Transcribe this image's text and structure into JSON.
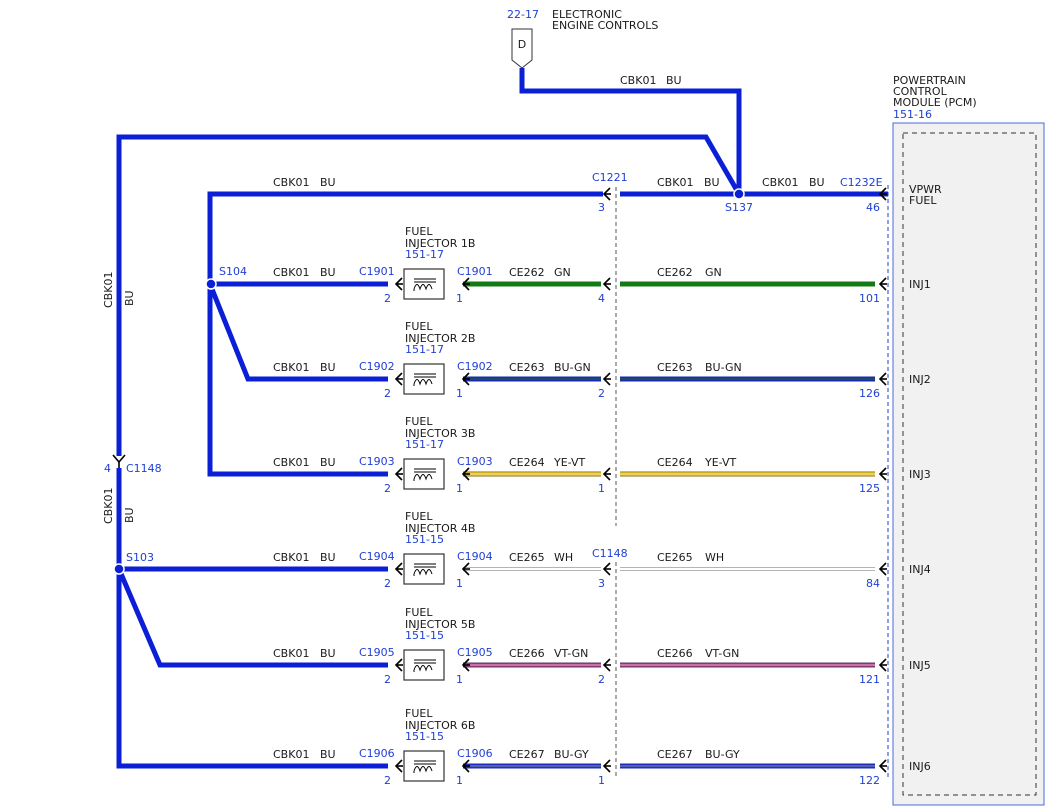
{
  "header": {
    "ref": "22-17",
    "title_line1": "ELECTRONIC",
    "title_line2": "ENGINE CONTROLS",
    "connector_letter": "D"
  },
  "pcm": {
    "line1": "POWERTRAIN",
    "line2": "CONTROL",
    "line3": "MODULE (PCM)",
    "ref": "151-16",
    "vpwr_line1": "VPWR",
    "vpwr_line2": "FUEL",
    "vpwr_connector": "C1232E",
    "vpwr_pin": "46"
  },
  "feed": {
    "top_circuit": "CBK01",
    "top_color": "BU",
    "splice_s137": "S137",
    "mid_left_circuit": "CBK01",
    "mid_left_color": "BU",
    "mid_right_circuit": "CBK01",
    "mid_right_color": "BU",
    "c1221_label": "C1221",
    "c1221_pin": "3",
    "left_circuit": "CBK01",
    "left_color": "BU",
    "vert_circuit_upper": "CBK01",
    "vert_color_upper": "BU",
    "vert_circuit_lower": "CBK01",
    "vert_color_lower": "BU",
    "c1148_pin": "4",
    "c1148_label": "C1148",
    "splice_s104": "S104",
    "splice_s103": "S103",
    "c1148_mid_label": "C1148"
  },
  "injectors": [
    {
      "name1": "FUEL",
      "name2": "INJECTOR 1B",
      "ref": "151-17",
      "conn": "C1901",
      "feed_circuit": "CBK01",
      "feed_color": "BU",
      "pin_in": "2",
      "pin_out": "1",
      "circuit": "CE262",
      "color": "GN",
      "mid_pin": "4",
      "pcm_pin": "101",
      "pcm_label": "INJ1"
    },
    {
      "name1": "FUEL",
      "name2": "INJECTOR 2B",
      "ref": "151-17",
      "conn": "C1902",
      "feed_circuit": "CBK01",
      "feed_color": "BU",
      "pin_in": "2",
      "pin_out": "1",
      "circuit": "CE263",
      "color": "BU-GN",
      "mid_pin": "2",
      "pcm_pin": "126",
      "pcm_label": "INJ2"
    },
    {
      "name1": "FUEL",
      "name2": "INJECTOR 3B",
      "ref": "151-17",
      "conn": "C1903",
      "feed_circuit": "CBK01",
      "feed_color": "BU",
      "pin_in": "2",
      "pin_out": "1",
      "circuit": "CE264",
      "color": "YE-VT",
      "mid_pin": "1",
      "pcm_pin": "125",
      "pcm_label": "INJ3"
    },
    {
      "name1": "FUEL",
      "name2": "INJECTOR 4B",
      "ref": "151-15",
      "conn": "C1904",
      "feed_circuit": "CBK01",
      "feed_color": "BU",
      "pin_in": "2",
      "pin_out": "1",
      "circuit": "CE265",
      "color": "WH",
      "mid_pin": "3",
      "pcm_pin": "84",
      "pcm_label": "INJ4"
    },
    {
      "name1": "FUEL",
      "name2": "INJECTOR 5B",
      "ref": "151-15",
      "conn": "C1905",
      "feed_circuit": "CBK01",
      "feed_color": "BU",
      "pin_in": "2",
      "pin_out": "1",
      "circuit": "CE266",
      "color": "VT-GN",
      "mid_pin": "2",
      "pcm_pin": "121",
      "pcm_label": "INJ5"
    },
    {
      "name1": "FUEL",
      "name2": "INJECTOR 6B",
      "ref": "151-15",
      "conn": "C1906",
      "feed_circuit": "CBK01",
      "feed_color": "BU",
      "pin_in": "2",
      "pin_out": "1",
      "circuit": "CE267",
      "color": "BU-GY",
      "mid_pin": "1",
      "pcm_pin": "122",
      "pcm_label": "INJ6"
    }
  ],
  "wire_colors": {
    "BU": "#0a1fd6",
    "GN": "#137a16",
    "BU-GN": "#1a2bb0",
    "YE-VT": "#e0bd2a",
    "WH": "#d0d0d0",
    "VT-GN": "#b0397f",
    "BU-GY": "#1f2fb8",
    "label_blue": "#1f3fd6",
    "pcm_fill": "#f1f1f1",
    "pcm_border": "#4a68e0"
  }
}
